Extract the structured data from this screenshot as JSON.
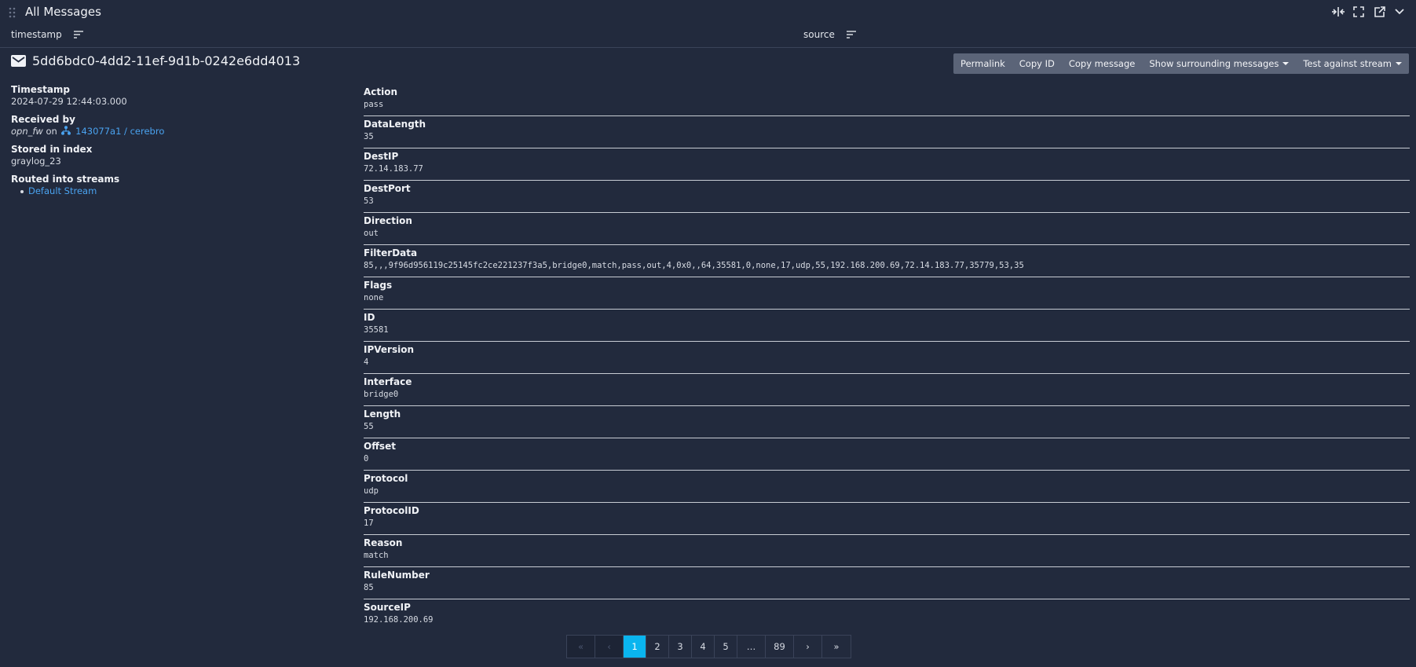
{
  "panel": {
    "title": "All Messages"
  },
  "columns": {
    "left": "timestamp",
    "right": "source"
  },
  "message": {
    "id": "5dd6bdc0-4dd2-11ef-9d1b-0242e6dd4013",
    "actions": {
      "permalink": "Permalink",
      "copy_id": "Copy ID",
      "copy_message": "Copy message",
      "surrounding": "Show surrounding messages",
      "test_stream": "Test against stream"
    },
    "meta": {
      "timestamp_label": "Timestamp",
      "timestamp_value": "2024-07-29 12:44:03.000",
      "received_label": "Received by",
      "received_input": "opn_fw",
      "received_on": "on",
      "received_node": "143077a1 / cerebro",
      "index_label": "Stored in index",
      "index_value": "graylog_23",
      "streams_label": "Routed into streams",
      "streams": [
        "Default Stream"
      ]
    },
    "fields": [
      {
        "name": "Action",
        "value": "pass"
      },
      {
        "name": "DataLength",
        "value": "35"
      },
      {
        "name": "DestIP",
        "value": "72.14.183.77"
      },
      {
        "name": "DestPort",
        "value": "53"
      },
      {
        "name": "Direction",
        "value": "out"
      },
      {
        "name": "FilterData",
        "value": "85,,,9f96d956119c25145fc2ce221237f3a5,bridge0,match,pass,out,4,0x0,,64,35581,0,none,17,udp,55,192.168.200.69,72.14.183.77,35779,53,35"
      },
      {
        "name": "Flags",
        "value": "none"
      },
      {
        "name": "ID",
        "value": "35581"
      },
      {
        "name": "IPVersion",
        "value": "4"
      },
      {
        "name": "Interface",
        "value": "bridge0"
      },
      {
        "name": "Length",
        "value": "55"
      },
      {
        "name": "Offset",
        "value": "0"
      },
      {
        "name": "Protocol",
        "value": "udp"
      },
      {
        "name": "ProtocolID",
        "value": "17"
      },
      {
        "name": "Reason",
        "value": "match"
      },
      {
        "name": "RuleNumber",
        "value": "85"
      },
      {
        "name": "SourceIP",
        "value": "192.168.200.69"
      }
    ]
  },
  "pagination": {
    "first": "«",
    "prev": "‹",
    "pages": [
      "1",
      "2",
      "3",
      "4",
      "5"
    ],
    "ellipsis": "…",
    "last_page": "89",
    "next": "›",
    "last": "»",
    "active": "1"
  },
  "colors": {
    "background": "#222a3d",
    "link": "#4aa3f0",
    "active_page": "#0ab5ef",
    "button_group": "#5b6478"
  }
}
